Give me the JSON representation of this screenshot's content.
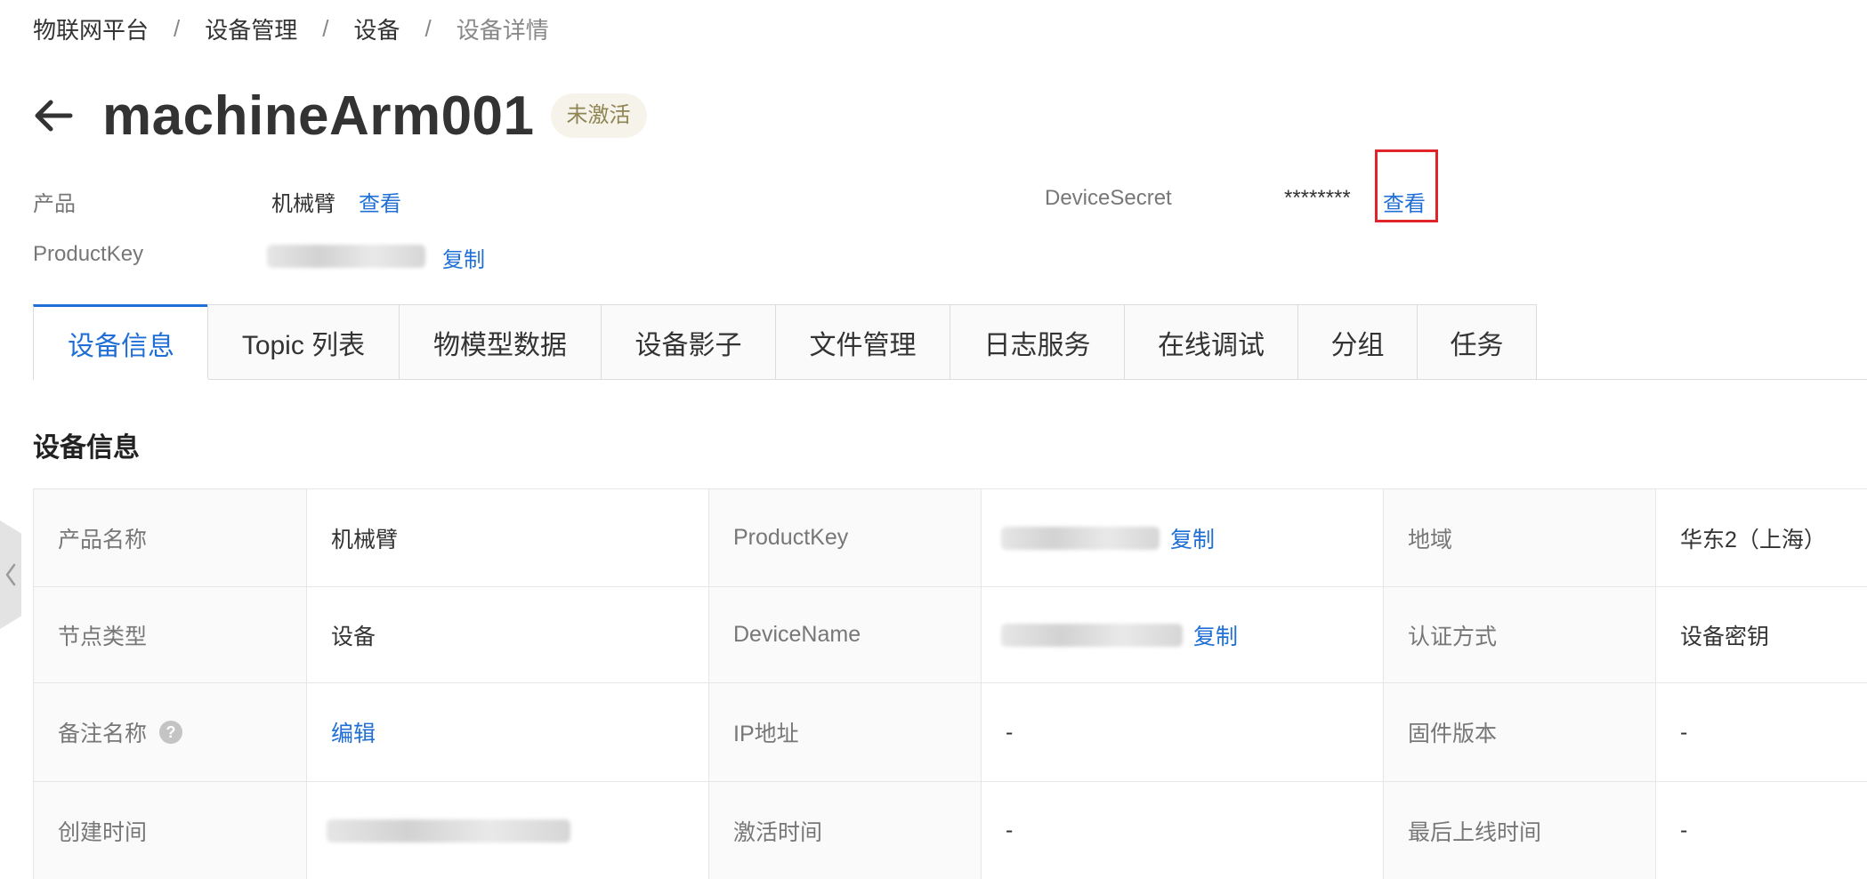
{
  "breadcrumb": {
    "items": [
      "物联网平台",
      "设备管理",
      "设备"
    ],
    "separator": "/",
    "current": "设备详情"
  },
  "header": {
    "title": "machineArm001",
    "status": "未激活"
  },
  "meta": {
    "product_label": "产品",
    "product_value": "机械臂",
    "product_link": "查看",
    "productkey_label": "ProductKey",
    "productkey_copy": "复制",
    "secret_label": "DeviceSecret",
    "secret_mask": "********",
    "secret_link": "查看"
  },
  "tabs": [
    {
      "label": "设备信息",
      "active": true
    },
    {
      "label": "Topic 列表"
    },
    {
      "label": "物模型数据"
    },
    {
      "label": "设备影子"
    },
    {
      "label": "文件管理"
    },
    {
      "label": "日志服务"
    },
    {
      "label": "在线调试"
    },
    {
      "label": "分组"
    },
    {
      "label": "任务"
    }
  ],
  "section": {
    "title": "设备信息"
  },
  "table": {
    "rows": [
      {
        "c1_label": "产品名称",
        "c1_value": "机械臂",
        "c2_label": "ProductKey",
        "c2_copy": "复制",
        "c3_label": "地域",
        "c3_value": "华东2（上海）"
      },
      {
        "c1_label": "节点类型",
        "c1_value": "设备",
        "c2_label": "DeviceName",
        "c2_copy": "复制",
        "c3_label": "认证方式",
        "c3_value": "设备密钥"
      },
      {
        "c1_label": "备注名称",
        "c1_link": "编辑",
        "c2_label": "IP地址",
        "c2_value": "-",
        "c3_label": "固件版本",
        "c3_value": "-"
      },
      {
        "c1_label": "创建时间",
        "c2_label": "激活时间",
        "c2_value": "-",
        "c3_label": "最后上线时间",
        "c3_value": "-"
      }
    ]
  },
  "icons": {
    "back": "arrow-left-icon",
    "help": "question-icon",
    "side": "chevron-left-icon"
  },
  "colors": {
    "link": "#1f6fd6",
    "highlight": "#e0242c",
    "badge_bg": "#f6f4ea",
    "badge_text": "#8f8453"
  }
}
